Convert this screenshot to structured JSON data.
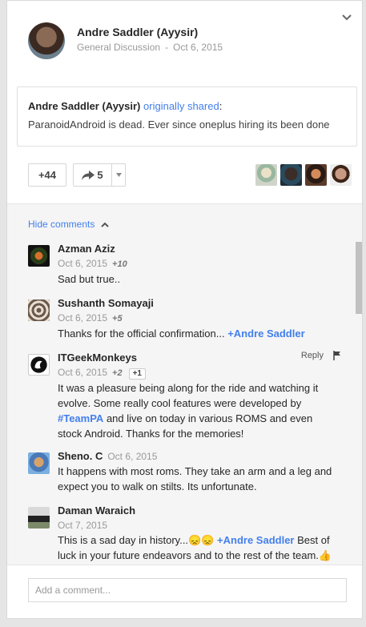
{
  "post": {
    "author": "Andre Saddler (Ayysir)",
    "category": "General Discussion",
    "separator": "-",
    "date": "Oct 6, 2015"
  },
  "shared": {
    "author": "Andre Saddler (Ayysir)",
    "link_text": "originally shared",
    "colon": ":",
    "text": "ParanoidAndroid is dead. Ever since oneplus hiring its been done"
  },
  "actions": {
    "plus_count": "+44",
    "share_count": "5"
  },
  "comments_toggle": "Hide comments",
  "comments": [
    {
      "name": "Azman Aziz",
      "date": "Oct 6, 2015",
      "plus": "+10",
      "text": "Sad but true.."
    },
    {
      "name": "Sushanth Somayaji",
      "date": "Oct 6, 2015",
      "plus": "+5",
      "text": "Thanks for the official confirmation... ",
      "mention": "+Andre Saddler"
    },
    {
      "name": "ITGeekMonkeys",
      "date": "Oct 6, 2015",
      "plus": "+2",
      "plus_button": "+1",
      "reply": "Reply",
      "text_a": "It was a pleasure being along for the ride and watching it evolve. Some really cool features were developed by ",
      "hashtag": "#TeamPA",
      "text_b": " and live on today in various ROMS and even stock Android. Thanks for the memories!"
    },
    {
      "name": "Sheno. C",
      "date": "Oct 6, 2015",
      "text": "It happens with most roms. They take an arm and a leg and expect you to walk on stilts. Its unfortunate."
    },
    {
      "name": "Daman Waraich",
      "date": "Oct 7, 2015",
      "text_a": "This is a sad day in history...😞😞 ",
      "mention": "+Andre Saddler",
      "text_b": " Best of luck in your future endeavors and to the rest of the team.👍👍👍"
    }
  ],
  "composer": {
    "placeholder": "Add a comment..."
  },
  "icons": {
    "collapse": "chevron-down-icon",
    "share": "share-arrow-icon",
    "hide_comments": "chevron-up-icon",
    "flag": "flag-icon"
  },
  "colors": {
    "link": "#427fed",
    "comments_bg": "#f5f5f5"
  }
}
